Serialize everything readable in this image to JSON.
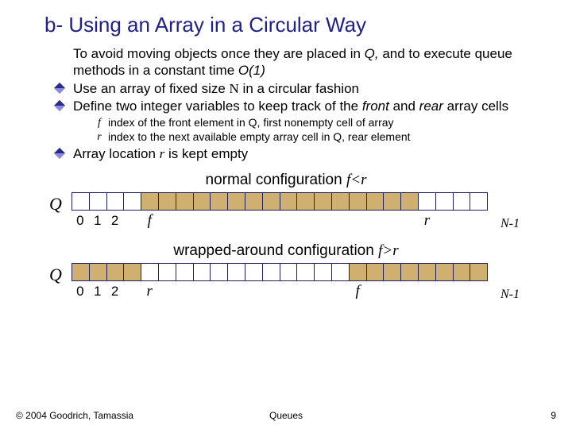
{
  "title": "b- Using an Array in a Circular Way",
  "bullets": {
    "b0": {
      "plain1": "To avoid moving objects once they are placed in ",
      "q": "Q,",
      "plain2": " and to execute queue methods in a constant time ",
      "o1": "O(1)"
    },
    "b1": {
      "plain1": "Use an array of fixed size ",
      "n": "N",
      "plain2": " in a circular fashion"
    },
    "b2": {
      "plain1": "Define two integer variables to keep track of the ",
      "front": "front",
      "plain2": " and ",
      "rear": "rear",
      "plain3": " array cells"
    },
    "b3": {
      "plain1": "Array location ",
      "r": "r",
      "plain2": " is kept empty"
    }
  },
  "sub": {
    "f": {
      "var": "f",
      "text1": "index of the front element in ",
      "q": "Q,",
      "text2": " first nonempty cell of array"
    },
    "r": {
      "var": "r",
      "text1": "index to the next available empty array cell in ",
      "q": "Q,",
      "text2": " rear element"
    }
  },
  "config1": {
    "label": "normal configuration ",
    "cond": "f<r"
  },
  "config2": {
    "label": "wrapped-around configuration ",
    "cond": "f>r"
  },
  "array": {
    "q": "Q",
    "idx0": "0",
    "idx1": "1",
    "idx2": "2",
    "f": "f",
    "r": "r",
    "nminus": "N-1"
  },
  "footer": {
    "copy": "© 2004 Goodrich, Tamassia",
    "title": "Queues",
    "page": "9"
  },
  "chart_data": [
    {
      "type": "table",
      "title": "normal configuration f<r",
      "n_cells": 24,
      "filled_indices": [
        4,
        5,
        6,
        7,
        8,
        9,
        10,
        11,
        12,
        13,
        14,
        15,
        16,
        17,
        18,
        19
      ],
      "labels": {
        "0": "0",
        "1": "1",
        "2": "2",
        "4": "f",
        "20": "r",
        "end": "N-1"
      }
    },
    {
      "type": "table",
      "title": "wrapped-around configuration f>r",
      "n_cells": 24,
      "filled_indices": [
        0,
        1,
        2,
        3,
        16,
        17,
        18,
        19,
        20,
        21,
        22,
        23
      ],
      "labels": {
        "0": "0",
        "1": "1",
        "2": "2",
        "4": "r",
        "16": "f",
        "end": "N-1"
      }
    }
  ]
}
